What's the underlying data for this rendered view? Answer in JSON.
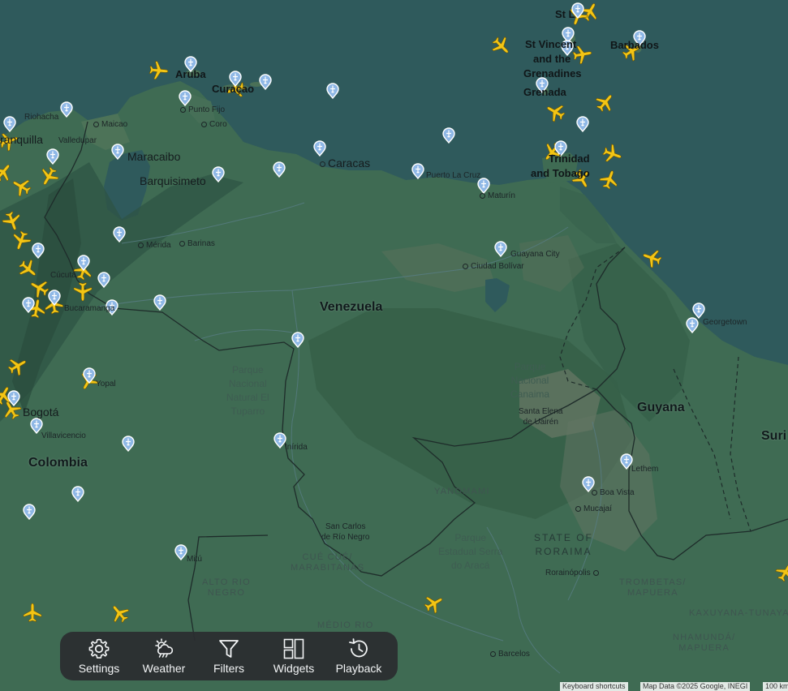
{
  "colors": {
    "water": "#2f5a5c",
    "land": "#3f6b53",
    "land_dark": "#345d48",
    "aircraft": "#f3c514",
    "pin": "#8fb8e6"
  },
  "labels": {
    "countries": {
      "venezuela": "Venezuela",
      "colombia": "Colombia",
      "guyana": "Guyana",
      "suriname_partial": "Suri"
    },
    "islands": {
      "aruba": "Aruba",
      "curacao": "Curaçao",
      "st_partial": "St L",
      "st_vincent_1": "St Vincent",
      "st_vincent_2": "and the",
      "st_vincent_3": "Grenadines",
      "grenada": "Grenada",
      "barbados": "Barbados",
      "trinidad_1": "Trinidad",
      "trinidad_2": "and Tobago"
    },
    "cities_large": {
      "maracaibo": "Maracaibo",
      "barquisimeto": "Barquisimeto",
      "caracas": "Caracas",
      "bogota": "Bogotá",
      "barranquilla_partial": "ranquilla"
    },
    "cities_small": {
      "riohacha": "Riohacha",
      "maicao": "Maicao",
      "valledupar": "Valledupar",
      "punto_fijo": "Punto Fijo",
      "coro": "Coro",
      "puerto_la_cruz": "Puerto La Cruz",
      "maturin": "Maturín",
      "merida": "Mérida",
      "barinas": "Barinas",
      "cucuta": "Cúcuta",
      "bucaramanga": "Bucaramanga",
      "guayana_city": "Guayana City",
      "ciudad_bolivar": "Ciudad Bolívar",
      "georgetown": "Georgetown",
      "yopal": "Yopal",
      "villavicencio": "Villavicencio",
      "inirida": "Inírida",
      "lethem": "Lethem",
      "boa_vista": "Boa Vista",
      "mucajai": "Mucajaí",
      "rorainopolis": "Rorainópolis",
      "mitu": "Mitú",
      "barcelos": "Barcelos",
      "san_carlos_1": "San Carlos",
      "san_carlos_2": "de Río Negro",
      "santa_elena_1": "Santa Elena",
      "santa_elena_2": "de Uairén"
    },
    "parks": {
      "tuparro_1": "Parque",
      "tuparro_2": "Nacional",
      "tuparro_3": "Natural El",
      "tuparro_4": "Tuparro",
      "canaima_1": "Parque",
      "canaima_2": "Nacional",
      "canaima_3": "Canaima",
      "araca_1": "Parque",
      "araca_2": "Estadual Serra",
      "araca_3": "do Aracá"
    },
    "regions": {
      "yanomami": "YANOMAMI",
      "roraima_1": "STATE OF",
      "roraima_2": "RORAIMA",
      "cuecue_1": "CUÉ CUÉ/",
      "cuecue_2": "MARABITANAS",
      "alto_rio_1": "ALTO RIO",
      "alto_rio_2": "NEGRO",
      "medio_rio": "MÉDIO RIO",
      "trombetas_1": "TROMBETAS/",
      "trombetas_2": "MAPUERA",
      "kaxuyana": "KAXUYANA-TUNAYAN",
      "nhamunda_1": "NHAMUNDÁ/",
      "nhamunda_2": "MAPUERA"
    }
  },
  "toolbar": [
    {
      "label": "Settings",
      "icon": "gear-icon"
    },
    {
      "label": "Weather",
      "icon": "weather-icon"
    },
    {
      "label": "Filters",
      "icon": "filter-icon"
    },
    {
      "label": "Widgets",
      "icon": "widgets-icon"
    },
    {
      "label": "Playback",
      "icon": "history-icon"
    }
  ],
  "attribution": {
    "shortcuts": "Keyboard shortcuts",
    "map_data": "Map Data ©2025 Google, INEGI",
    "scale": "100 km"
  }
}
